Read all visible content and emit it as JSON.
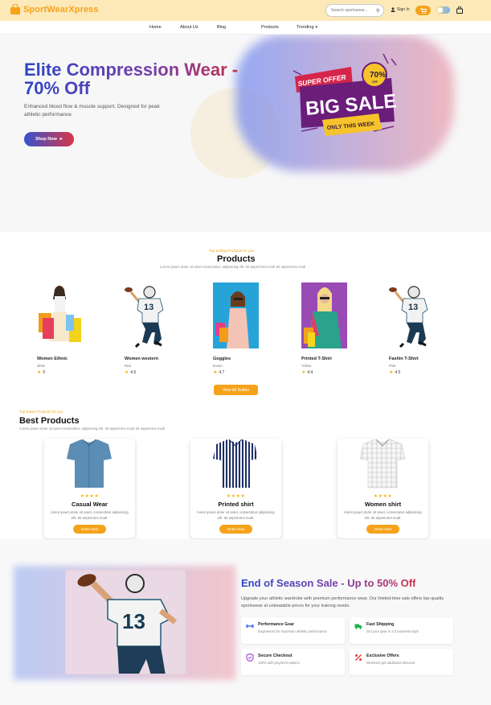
{
  "brand": {
    "name": "SportWearXpress",
    "color": "#f5a31a"
  },
  "header": {
    "search_placeholder": "Search sportswear...",
    "signin_label": "Sign In"
  },
  "nav": {
    "items": [
      {
        "label": "Home"
      },
      {
        "label": "About Us"
      },
      {
        "label": "Blog"
      },
      {
        "label": "Products"
      },
      {
        "label": "Trending"
      }
    ]
  },
  "hero": {
    "title": "Elite Compression Wear - 70% Off",
    "subtitle": "Enhanced blood flow & muscle support. Designed for peak athletic performance.",
    "cta_label": "Shop Now",
    "banner": {
      "top_line": "SUPER OFFER",
      "main": "BIG SALE",
      "tag": "ONLY THIS WEEK",
      "badge": "70%",
      "badge_sub": "OFF"
    }
  },
  "products_section": {
    "kicker": "Top Selling Products for you",
    "title": "Products",
    "description": "Lorem ipsum dolor sit amet consectetur, adipisicing elit. Sit asperiores modi Sit asperiores modi",
    "items": [
      {
        "name": "Women Ethnic",
        "color": "white",
        "rating": "5"
      },
      {
        "name": "Women western",
        "color": "Red",
        "rating": "4.5"
      },
      {
        "name": "Goggles",
        "color": "brown",
        "rating": "4.7"
      },
      {
        "name": "Printed T-Shirt",
        "color": "Yellow",
        "rating": "4.4"
      },
      {
        "name": "Fashin T-Shirt",
        "color": "Pink",
        "rating": "4.5"
      }
    ],
    "view_all_label": "View All Button"
  },
  "best_section": {
    "kicker": "Top Rated Products for you",
    "title": "Best Products",
    "description": "Lorem ipsum dolor sit amet consectetur, adipisicing elit. Sit asperiores modi Sit asperiores modi",
    "items": [
      {
        "name": "Casual Wear",
        "stars": "★★★★",
        "desc": "lorem ipsum dolor sit amet, consectetur adipisicing elit. Sit asperiores modi.",
        "button": "Order Now"
      },
      {
        "name": "Printed shirt",
        "stars": "★★★★",
        "desc": "lorem ipsum dolor sit amet, consectetur adipisicing elit. Sit asperiores modi.",
        "button": "Order Now"
      },
      {
        "name": "Women shirt",
        "stars": "★★★★",
        "desc": "lorem ipsum dolor sit amet, consectetur adipisicing elit. Sit asperiores modi.",
        "button": "Order Now"
      }
    ]
  },
  "sale_section": {
    "title": "End of Season Sale - Up to 50% Off",
    "description": "Upgrade your athletic wardrobe with premium performance wear. Our limited-time sale offers top-quality sportswear at unbeatable prices for your training needs.",
    "features": [
      {
        "title": "Performance Gear",
        "desc": "Engineered for maximum athletic performance",
        "icon": "dumbbell-icon",
        "color": "#4a6cf0"
      },
      {
        "title": "Fast Shipping",
        "desc": "Get your gear in 2-3 business days",
        "icon": "truck-icon",
        "color": "#1fb24a"
      },
      {
        "title": "Secure Checkout",
        "desc": "100% safe payment options",
        "icon": "shield-icon",
        "color": "#9b3fd6"
      },
      {
        "title": "Exclusive Offers",
        "desc": "Members get additional discount",
        "icon": "percent-icon",
        "color": "#e03a3a"
      }
    ]
  }
}
